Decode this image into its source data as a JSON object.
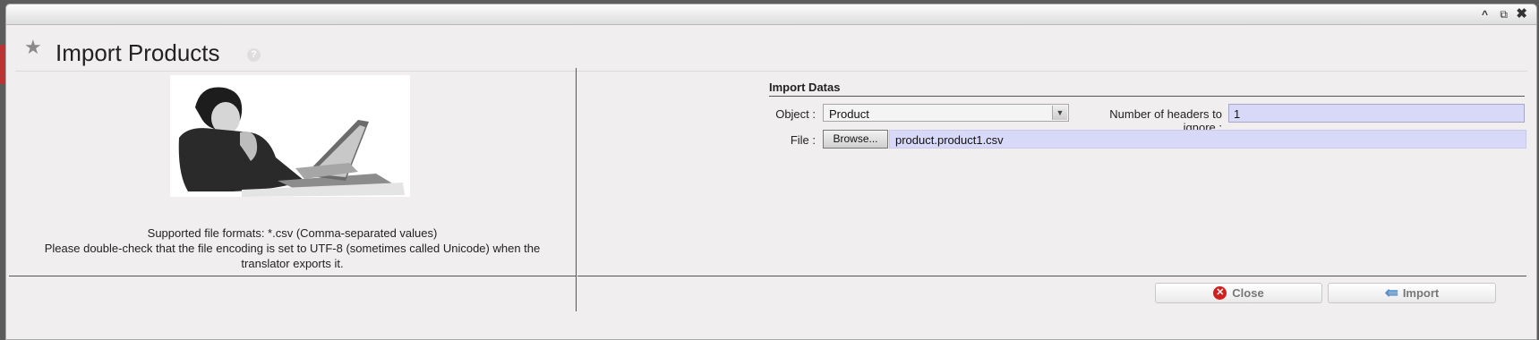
{
  "window": {
    "collapse_glyph": "^",
    "popout_glyph": "⧉",
    "close_glyph": "✖"
  },
  "header": {
    "title": "Import Products",
    "help_glyph": "?"
  },
  "info": {
    "line1": "Supported file formats: *.csv (Comma-separated values)",
    "line2": "Please double-check that the file encoding is set to UTF-8 (sometimes called Unicode) when the",
    "line3": "translator exports it."
  },
  "form": {
    "section_title": "Import Datas",
    "object_label": "Object :",
    "object_value": "Product",
    "headers_label": "Number of headers to ignore :",
    "headers_value": "1",
    "file_label": "File :",
    "browse_label": "Browse...",
    "file_value": "product.product1.csv"
  },
  "actions": {
    "close_label": "Close",
    "import_label": "Import"
  },
  "colors": {
    "input_fill": "#d8d8f8",
    "close_icon": "#d21f1f",
    "import_icon": "#5b8fc7"
  }
}
